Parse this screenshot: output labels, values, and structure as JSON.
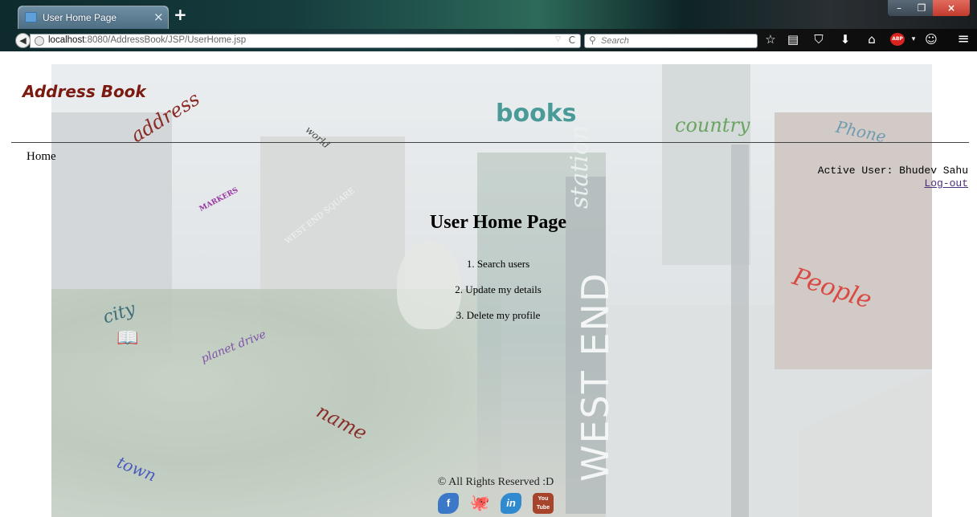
{
  "browser": {
    "tab_title": "User Home Page",
    "tab_close": "×",
    "new_tab": "+",
    "url_host": "localhost",
    "url_path": ":8080/AddressBook/JSP/UserHome.jsp",
    "search_placeholder": "Search",
    "reload_icon": "C",
    "window": {
      "min": "–",
      "max": "❐",
      "close": "×"
    }
  },
  "page": {
    "brand": "Address Book",
    "nav_home": "Home",
    "active_user": "Active User: Bhudev Sahu",
    "logout": "Log-out",
    "title": "User Home Page",
    "menu": [
      "1. Search users",
      "2. Update my details",
      "3. Delete my profile"
    ],
    "footer": "© All Rights Reserved :D"
  },
  "background_words": {
    "address": "address",
    "world": "world",
    "books": "books",
    "country": "country",
    "phone": "Phone",
    "markers": "MARKERS",
    "west_end_square": "WEST END SQUARE",
    "station": "station",
    "west_end": "WEST END",
    "people": "People",
    "city": "city",
    "planet_drive": "planet drive",
    "name": "name",
    "town": "town"
  },
  "social": {
    "facebook_label": "f",
    "linkedin_label": "in",
    "youtube_label": "You Tube"
  },
  "colors": {
    "brand": "#7a1a10",
    "logout_link": "#4b2c7a",
    "close_button": "#c23a2c"
  }
}
